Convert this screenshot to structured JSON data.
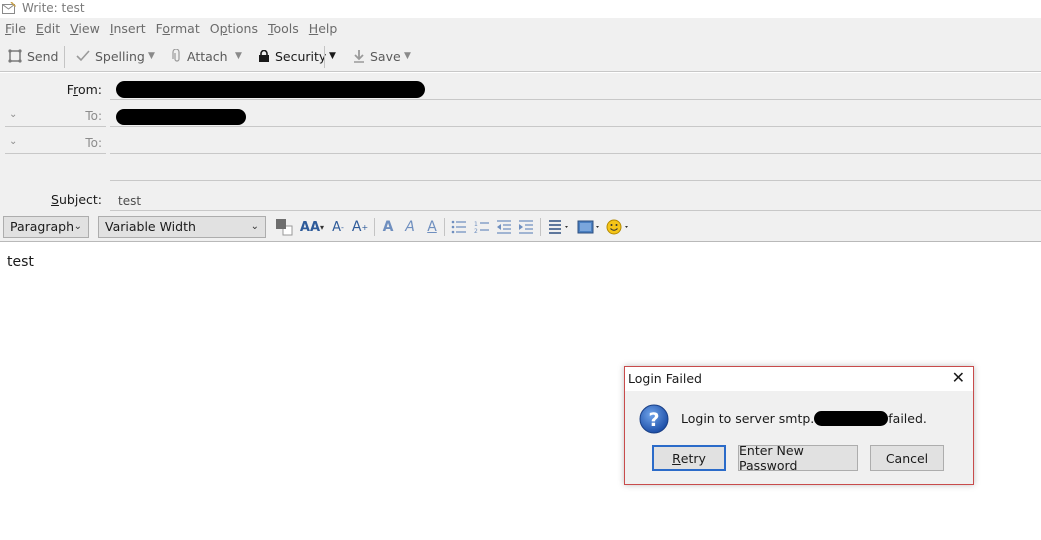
{
  "window": {
    "title": "Write: test"
  },
  "menu": [
    {
      "label": "File",
      "accel": "F",
      "rest": "ile"
    },
    {
      "label": "Edit",
      "accel": "E",
      "rest": "dit"
    },
    {
      "label": "View",
      "accel": "V",
      "rest": "iew"
    },
    {
      "label": "Insert",
      "accel": "I",
      "rest": "nsert"
    },
    {
      "label": "Format",
      "accel": "o",
      "pre": "F",
      "rest": "rmat"
    },
    {
      "label": "Options",
      "accel": "p",
      "pre": "O",
      "rest": "tions"
    },
    {
      "label": "Tools",
      "accel": "T",
      "rest": "ools"
    },
    {
      "label": "Help",
      "accel": "H",
      "rest": "elp"
    }
  ],
  "toolbar": {
    "send": "Send",
    "spelling": "Spelling",
    "attach": "Attach",
    "security": "Security",
    "save": "Save"
  },
  "headers": {
    "from_label_accel": "r",
    "from_label_pre": "F",
    "from_label_rest": "om:",
    "to_label": "To:",
    "subject_label_accel": "S",
    "subject_label_rest": "ubject:",
    "subject_value": "test"
  },
  "format_bar": {
    "paragraph": "Paragraph",
    "font": "Variable Width"
  },
  "body": {
    "text": "test"
  },
  "dialog": {
    "title": "Login Failed",
    "message_prefix": "Login to server smtp.",
    "message_suffix": "failed.",
    "retry_accel": "R",
    "retry_rest": "etry",
    "enter_new_password": "Enter New Password",
    "cancel": "Cancel"
  },
  "colors": {
    "accent": "#2b6bc9",
    "dialog_border": "#c84b4b",
    "chrome": "#f0f0f0"
  }
}
